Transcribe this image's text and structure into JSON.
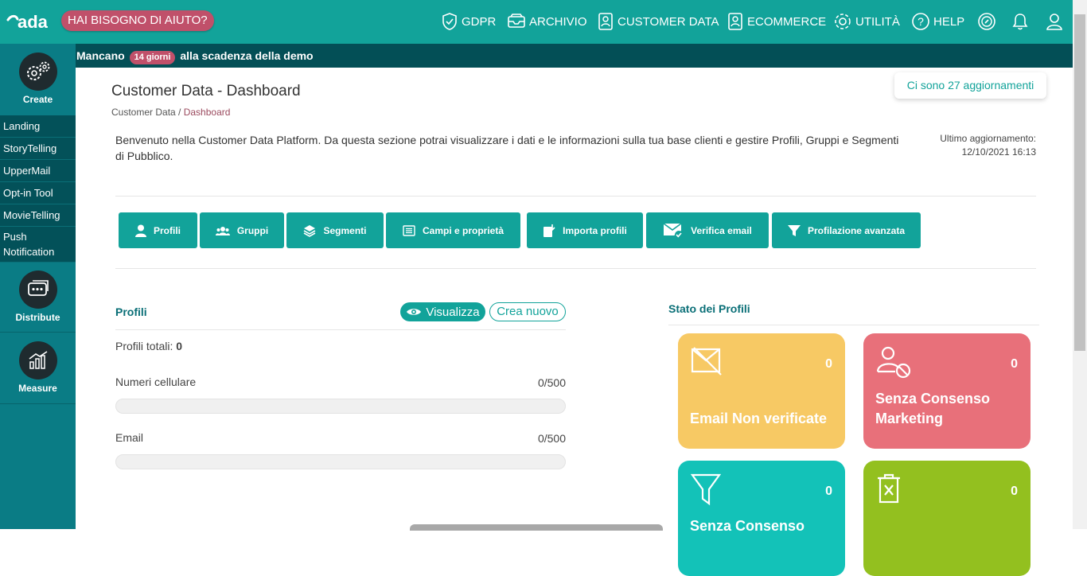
{
  "brand": {
    "logo": "ada"
  },
  "header": {
    "help": "HAI BISOGNO DI AIUTO?",
    "nav": {
      "gdpr": "GDPR",
      "archivio": "ARCHIVIO",
      "customer": "CUSTOMER DATA",
      "ecommerce": "ECOMMERCE",
      "utilita": "UTILITÀ",
      "help": "HELP"
    },
    "icons": [
      "shield-check-icon",
      "inbox-icon",
      "customer-data-icon",
      "ecommerce-icon",
      "gear-icon",
      "question-icon",
      "compass-icon",
      "bell-icon",
      "user-icon"
    ]
  },
  "demo": {
    "prefix": "Mancano",
    "days": "14 giorni",
    "suffix": "alla scadenza della demo"
  },
  "sidebar": {
    "create": "Create",
    "items": [
      "Landing",
      "StoryTelling",
      "UpperMail",
      "Opt-in Tool",
      "MovieTelling",
      "Push Notification"
    ],
    "distribute": "Distribute",
    "measure": "Measure"
  },
  "page": {
    "title": "Customer Data - Dashboard",
    "breadcrumb_root": "Customer Data",
    "breadcrumb_sep": " / ",
    "breadcrumb_current": "Dashboard",
    "updates": "Ci sono 27 aggiornamenti",
    "welcome": "Benvenuto nella Customer Data Platform. Da questa sezione potrai visualizzare i dati e le informazioni sulla tua base clienti e gestire Profili, Gruppi e Segmenti di Pubblico.",
    "last_update_label": "Ultimo aggiornamento:",
    "last_update_value": "12/10/2021 16:13"
  },
  "toolbar": {
    "profili": "Profili",
    "gruppi": "Gruppi",
    "segmenti": "Segmenti",
    "campi": "Campi e proprietà",
    "importa": "Importa profili",
    "verifica": "Verifica email",
    "profilazione": "Profilazione avanzata"
  },
  "profili": {
    "title": "Profili",
    "view": "Visualizza",
    "create": "Crea nuovo",
    "total_label": "Profili totali:",
    "total_value": "0",
    "mobile_label": "Numeri cellulare",
    "mobile_value": "0/500",
    "mobile_fraction": 0,
    "email_label": "Email",
    "email_value": "0/500",
    "email_fraction": 0
  },
  "stato": {
    "title": "Stato dei Profili",
    "cards": [
      {
        "label": "Email Non verificate",
        "count": "0",
        "color": "#f7c964"
      },
      {
        "label": "Senza Consenso Marketing",
        "count": "0",
        "color": "#e8707a"
      },
      {
        "label": "Senza Consenso",
        "count": "0",
        "color": "#13c2b8"
      },
      {
        "label": "",
        "count": "0",
        "color": "#93c01f"
      }
    ]
  },
  "colors": {
    "primary": "#12a39a",
    "dark": "#034f56",
    "sidebar": "#0a7c85",
    "accent": "#c0506a"
  }
}
